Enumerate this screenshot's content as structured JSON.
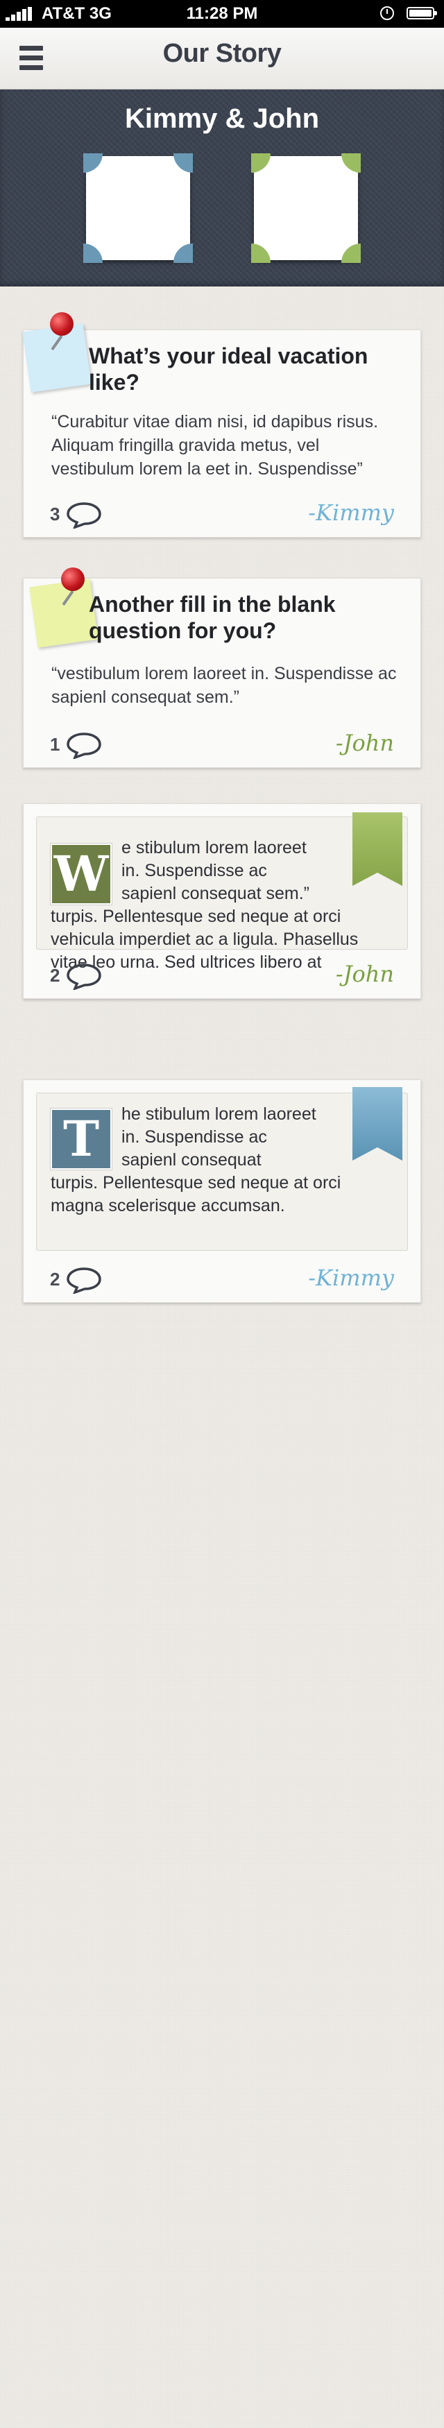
{
  "status_bar": {
    "carrier": "AT&T 3G",
    "time": "11:28 PM"
  },
  "nav": {
    "title": "Our Story",
    "menu_icon": "hamburger-menu-icon"
  },
  "header": {
    "names": "Kimmy & John",
    "photo_frames": [
      "kimmy",
      "john"
    ]
  },
  "colors": {
    "kimmy": "#6fb3d6",
    "john": "#7aa040",
    "blue_corner": "#6a99b5",
    "green_corner": "#9bbd62"
  },
  "cards": [
    {
      "type": "question",
      "question": "What’s your ideal vacation like?",
      "answer": "“Curabitur vitae diam nisi, id dapibus risus. Aliquam fringilla gravida metus, vel vestibulum lorem la eet in. Suspendisse”",
      "comments": "3",
      "signature": "-Kimmy",
      "note_color": "blue"
    },
    {
      "type": "question",
      "question": "Another fill in the blank question for you?",
      "answer": "“vestibulum lorem laoreet in. Suspendisse ac sapienl consequat sem.”",
      "comments": "1",
      "signature": "-John",
      "note_color": "yellow"
    },
    {
      "type": "story",
      "dropcap": "W",
      "lead": "e stibulum lorem laoreet in. Suspendisse ac sapienl consequat sem.”",
      "body": "turpis. Pellentesque sed neque at orci vehicula imperdiet ac a ligula. Phasellus vitae leo urna. Sed ultrices libero at",
      "comments": "2",
      "signature": "-John",
      "ribbon_color": "green"
    },
    {
      "type": "story",
      "dropcap": "T",
      "lead": "he stibulum lorem laoreet in. Suspendisse ac sapienl consequat",
      "body": "turpis. Pellentesque sed neque at orci magna scelerisque accumsan.",
      "comments": "2",
      "signature": "-Kimmy",
      "ribbon_color": "blue"
    }
  ]
}
